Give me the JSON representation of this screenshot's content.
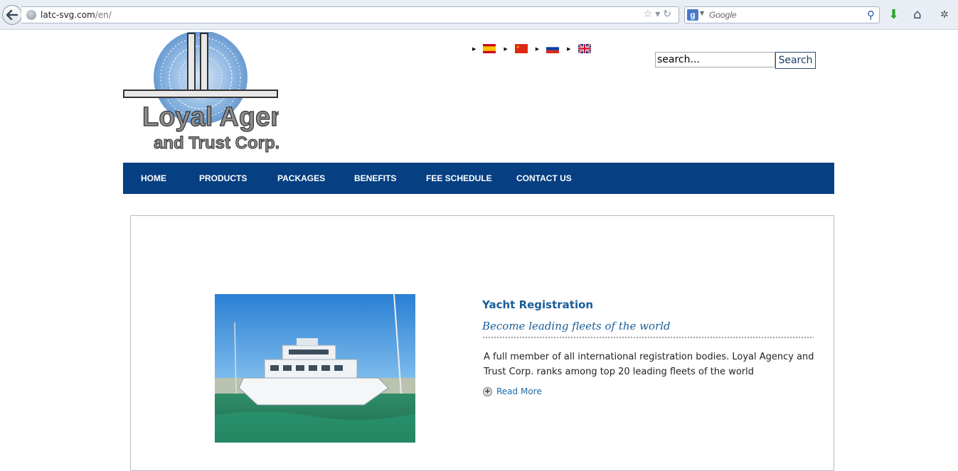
{
  "browser": {
    "url_host": "latc-svg.com",
    "url_path": "/en/",
    "search_placeholder": "Google"
  },
  "logo": {
    "line1": "Loyal Agency",
    "line2": "and Trust Corp."
  },
  "languages": [
    {
      "code": "es",
      "icon": "spain-flag-icon"
    },
    {
      "code": "cn",
      "icon": "china-flag-icon"
    },
    {
      "code": "ru",
      "icon": "russia-flag-icon"
    },
    {
      "code": "en",
      "icon": "uk-flag-icon"
    }
  ],
  "site_search": {
    "value": "search...",
    "button_label": "Search"
  },
  "nav": {
    "items": [
      "HOME",
      "PRODUCTS",
      "PACKAGES",
      "BENEFITS",
      "FEE SCHEDULE",
      "CONTACT US"
    ]
  },
  "post": {
    "title": "Yacht Registration",
    "subtitle": "Become leading fleets of the world",
    "body": "A full member of all international registration bodies. Loyal Agency and Trust Corp. ranks among top 20 leading fleets of the world",
    "read_more": "Read More"
  },
  "colors": {
    "nav_bg": "#063f82",
    "link": "#1a5d99"
  }
}
